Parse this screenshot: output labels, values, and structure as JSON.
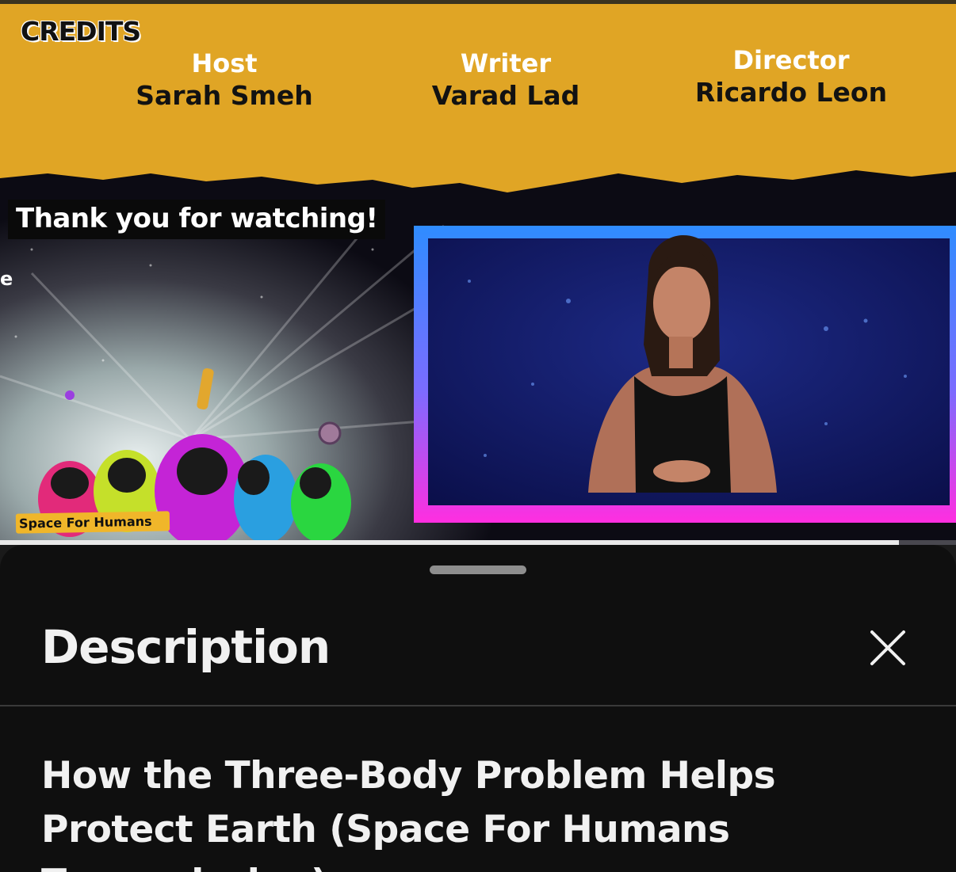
{
  "video": {
    "credits_heading": "CREDITS",
    "credits": [
      {
        "role": "Host",
        "name": "Sarah Smeh"
      },
      {
        "role": "Writer",
        "name": "Varad Lad"
      },
      {
        "role": "Director",
        "name": "Ricardo Leon"
      }
    ],
    "thanks_text": "Thank you for watching!",
    "edge_letter": "e",
    "badge_text": "Space For Humans",
    "progress_fraction": 0.94,
    "colors": {
      "banner": "#e0a525",
      "frame_blue": "#2f8cff",
      "frame_pink": "#ff2ee0"
    }
  },
  "sheet": {
    "title": "Description",
    "close_icon": "close-icon",
    "video_title": "How the Three-Body Problem Helps Protect Earth (Space For Humans Transmission)"
  }
}
